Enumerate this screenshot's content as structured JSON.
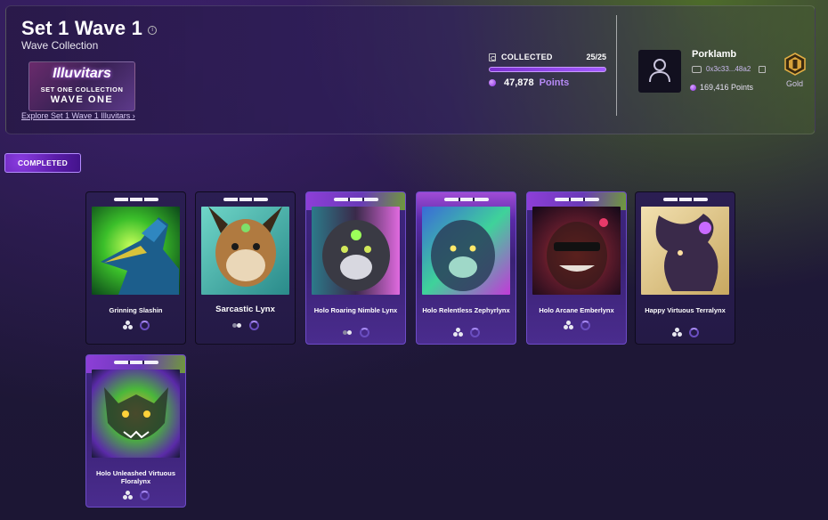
{
  "header": {
    "title": "Set 1 Wave 1",
    "subtitle": "Wave Collection",
    "logo": {
      "brand": "Illuvitars",
      "line1": "SET ONE COLLECTION",
      "line2": "WAVE ONE"
    },
    "explore_link": "Explore Set 1 Wave 1 Illuvitars ›",
    "collected": {
      "label": "COLLECTED",
      "count": "25/25",
      "progress": 1.0
    },
    "points": {
      "value": "47,878",
      "label": "Points"
    },
    "user": {
      "name": "Porklamb",
      "wallet": "0x3c33...48a2",
      "points": "169,416 Points",
      "rank": "Gold"
    }
  },
  "filter_tag": "COMPLETED",
  "cards": [
    {
      "name": "Grinning Slashin",
      "style": "normal",
      "icon": "trio"
    },
    {
      "name": "Sarcastic Lynx",
      "style": "normal",
      "icon": "duo"
    },
    {
      "name": "Holo Roaring Nimble Lynx",
      "style": "holo-green",
      "icon": "trio"
    },
    {
      "name": "Holo Relentless Zephyrlynx",
      "style": "holo",
      "icon": "trio"
    },
    {
      "name": "Holo Arcane Emberlynx",
      "style": "holo-green",
      "icon": "trio"
    },
    {
      "name": "Happy Virtuous Terralynx",
      "style": "normal",
      "icon": "trio"
    },
    {
      "name": "Holo Unleashed Virtuous Floralynx",
      "style": "holo-green",
      "icon": "trio"
    }
  ],
  "colors": {
    "accent": "#8a2be2",
    "points_label": "#b68af6",
    "rank_gold": "#d8a23a"
  }
}
